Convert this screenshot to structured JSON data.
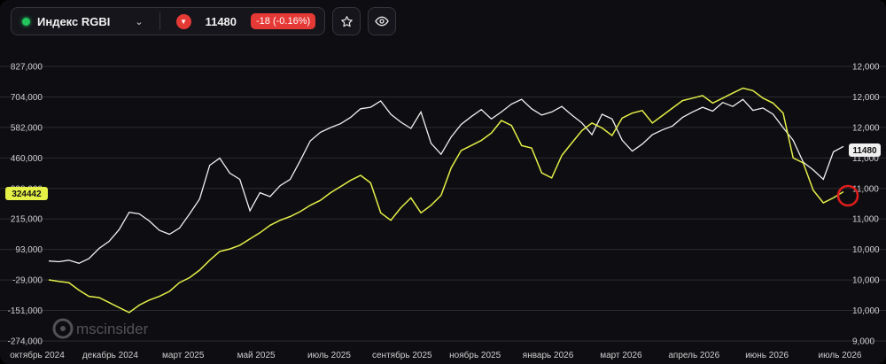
{
  "header": {
    "symbol_name": "Индекс RGBI",
    "chevron_icon": "chevron-down-icon",
    "status_color": "#22c55e",
    "price": "11480",
    "change": "-18 (-0.16%)",
    "change_icon": "triangle-down-icon",
    "star_icon": "star-outline-icon",
    "eye_icon": "eye-icon"
  },
  "watermark": {
    "text": "mscinsider",
    "icon": "msc-logo-icon"
  },
  "chart_data": {
    "type": "line",
    "left_axis": {
      "ticks": [
        "827,000",
        "704,000",
        "582,000",
        "460,000",
        "338,000",
        "215,000",
        "93,000",
        "-29,000",
        "-151,000",
        "-274,000"
      ],
      "ylim": [
        -274000,
        827000
      ]
    },
    "right_axis": {
      "ticks": [
        "12,000",
        "12,000",
        "12,000",
        "11,000",
        "11,000",
        "11,000",
        "10,000",
        "10,000",
        "10,000",
        "9,000"
      ],
      "ylim": [
        9000,
        12500
      ]
    },
    "x_ticks": [
      "октябрь 2024",
      "декабрь 2024",
      "март 2025",
      "май 2025",
      "июль 2025",
      "сентябрь 2025",
      "ноябрь 2025",
      "январь 2026",
      "март 2026",
      "апрель 2026",
      "июнь 2026",
      "июль 2026"
    ],
    "last_values": {
      "left": "324442",
      "right": "11480"
    },
    "colors": {
      "left_series": "#e4ef47",
      "right_series": "#f0f0f0",
      "marker": "#e11d1d"
    },
    "series": [
      {
        "axis": "right",
        "values": [
          10020,
          10010,
          10030,
          9990,
          10050,
          10180,
          10270,
          10420,
          10640,
          10620,
          10530,
          10410,
          10360,
          10440,
          10620,
          10810,
          11240,
          11330,
          11140,
          11060,
          10660,
          10890,
          10840,
          10980,
          11060,
          11300,
          11550,
          11660,
          11720,
          11770,
          11850,
          11960,
          11980,
          12060,
          11890,
          11790,
          11710,
          11920,
          11520,
          11380,
          11600,
          11760,
          11860,
          11950,
          11830,
          11920,
          12020,
          12080,
          11960,
          11880,
          11920,
          11990,
          11880,
          11780,
          11630,
          11890,
          11830,
          11560,
          11420,
          11510,
          11630,
          11690,
          11740,
          11850,
          11920,
          11980,
          11930,
          12040,
          11990,
          12080,
          11940,
          11970,
          11890,
          11720,
          11560,
          11280,
          11180,
          11060,
          11410,
          11480
        ]
      },
      {
        "axis": "left",
        "values": [
          -29000,
          -35000,
          -40000,
          -70000,
          -95000,
          -100000,
          -120000,
          -140000,
          -160000,
          -130000,
          -110000,
          -95000,
          -75000,
          -40000,
          -20000,
          10000,
          50000,
          85000,
          95000,
          110000,
          135000,
          160000,
          190000,
          210000,
          225000,
          245000,
          270000,
          290000,
          320000,
          345000,
          370000,
          390000,
          360000,
          240000,
          210000,
          260000,
          300000,
          240000,
          270000,
          310000,
          420000,
          490000,
          510000,
          530000,
          560000,
          610000,
          590000,
          510000,
          500000,
          400000,
          380000,
          470000,
          520000,
          570000,
          600000,
          580000,
          550000,
          620000,
          640000,
          650000,
          600000,
          630000,
          660000,
          690000,
          700000,
          710000,
          680000,
          700000,
          720000,
          740000,
          730000,
          700000,
          680000,
          640000,
          460000,
          440000,
          330000,
          280000,
          300000,
          324442
        ]
      }
    ]
  }
}
